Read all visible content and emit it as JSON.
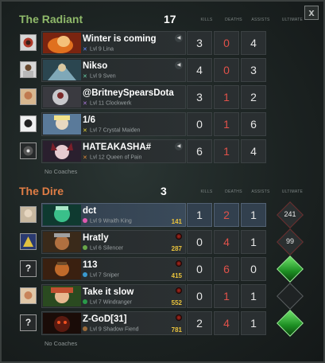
{
  "window": {
    "close_label": "x"
  },
  "columns": {
    "kills": "KILLS",
    "deaths": "DEATHS",
    "assists": "ASSISTS",
    "ultimate": "ULTIMATE"
  },
  "radiant": {
    "name": "The Radiant",
    "score": "17",
    "color": "#8fb96a",
    "players": [
      {
        "name": "Winter is coming",
        "level": "Lvl 9",
        "hero": "Lina",
        "kills": "3",
        "deaths": "0",
        "assists": "4"
      },
      {
        "name": "Nikso",
        "level": "Lvl 9",
        "hero": "Sven",
        "kills": "4",
        "deaths": "0",
        "assists": "3"
      },
      {
        "name": "@BritneySpearsDota",
        "level": "Lvl 11",
        "hero": "Clockwerk",
        "kills": "3",
        "deaths": "1",
        "assists": "2"
      },
      {
        "name": "1/6",
        "level": "Lvl 7",
        "hero": "Crystal Maiden",
        "kills": "0",
        "deaths": "1",
        "assists": "6"
      },
      {
        "name": "HATEAKASHA#",
        "level": "Lvl 12",
        "hero": "Queen of Pain",
        "kills": "6",
        "deaths": "1",
        "assists": "4"
      }
    ],
    "coaches": "No Coaches"
  },
  "dire": {
    "name": "The Dire",
    "score": "3",
    "color": "#e07d45",
    "players": [
      {
        "name": "dct",
        "level": "Lvl 9",
        "hero": "Wraith King",
        "gold": "141",
        "kills": "1",
        "deaths": "2",
        "assists": "1",
        "ult": "241"
      },
      {
        "name": "Hratly",
        "level": "Lvl 6",
        "hero": "Silencer",
        "gold": "287",
        "kills": "0",
        "deaths": "4",
        "assists": "1",
        "ult": "99"
      },
      {
        "name": "113",
        "level": "Lvl 7",
        "hero": "Sniper",
        "gold": "415",
        "kills": "0",
        "deaths": "6",
        "assists": "0",
        "ult": ""
      },
      {
        "name": "Take it slow",
        "level": "Lvl 7",
        "hero": "Windranger",
        "gold": "552",
        "kills": "0",
        "deaths": "1",
        "assists": "1",
        "ult": ""
      },
      {
        "name": "Z-GoD[31]",
        "level": "Lvl 9",
        "hero": "Shadow Fiend",
        "gold": "781",
        "kills": "2",
        "deaths": "4",
        "assists": "1",
        "ult": ""
      }
    ],
    "coaches": "No Coaches"
  },
  "unknown_icon": "?"
}
